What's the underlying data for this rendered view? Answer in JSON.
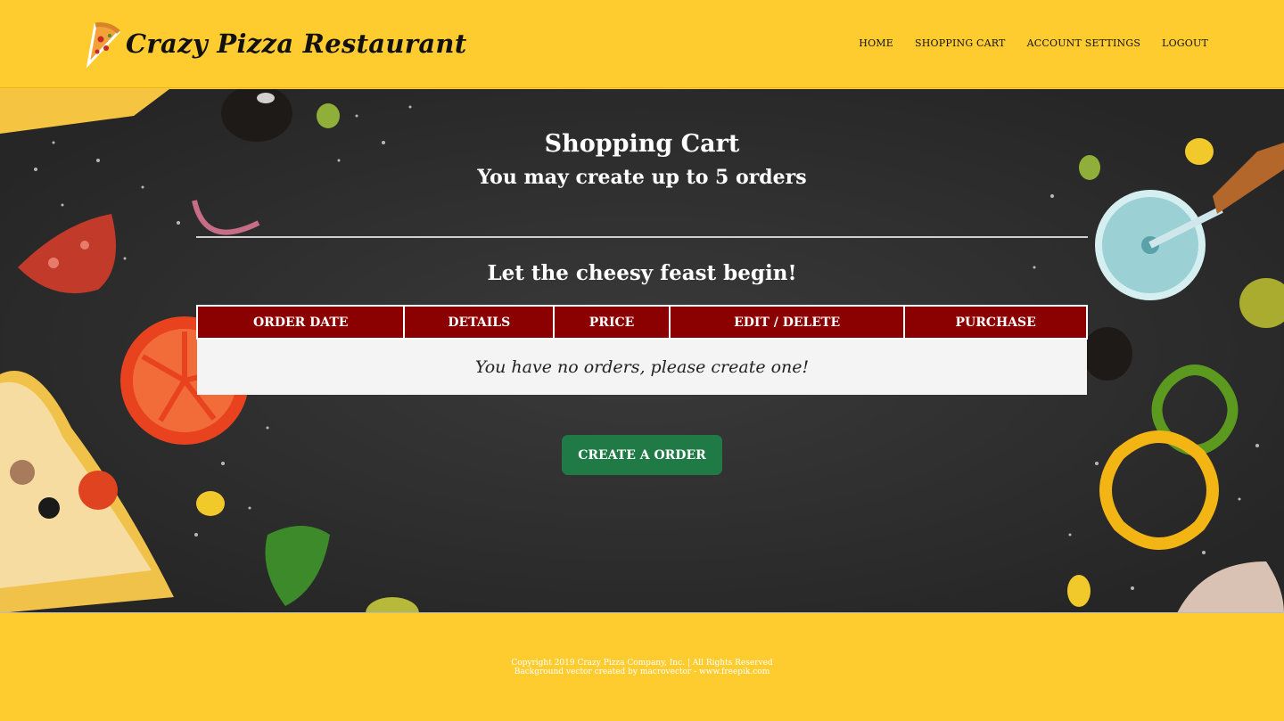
{
  "header": {
    "brand": "Crazy Pizza Restaurant",
    "nav": [
      "HOME",
      "SHOPPING CART",
      "ACCOUNT SETTINGS",
      "LOGOUT"
    ]
  },
  "main": {
    "title": "Shopping Cart",
    "subtitle": "You may create up to 5 orders",
    "tagline": "Let the cheesy feast begin!",
    "table": {
      "columns": [
        "ORDER DATE",
        "DETAILS",
        "PRICE",
        "EDIT / DELETE",
        "PURCHASE"
      ],
      "empty_message": "You have no orders, please create one!"
    },
    "create_button": "CREATE A ORDER"
  },
  "footer": {
    "copyright": "Copyright 2019 Crazy Pizza Company, Inc. | All Rights Reserved",
    "credit": "Background vector created by macrovector - www.freepik.com"
  },
  "colors": {
    "brand_yellow": "#ffcc2f",
    "board": "#2c2c2c",
    "table_header": "#8b0000",
    "button_green": "#1f7a45"
  }
}
